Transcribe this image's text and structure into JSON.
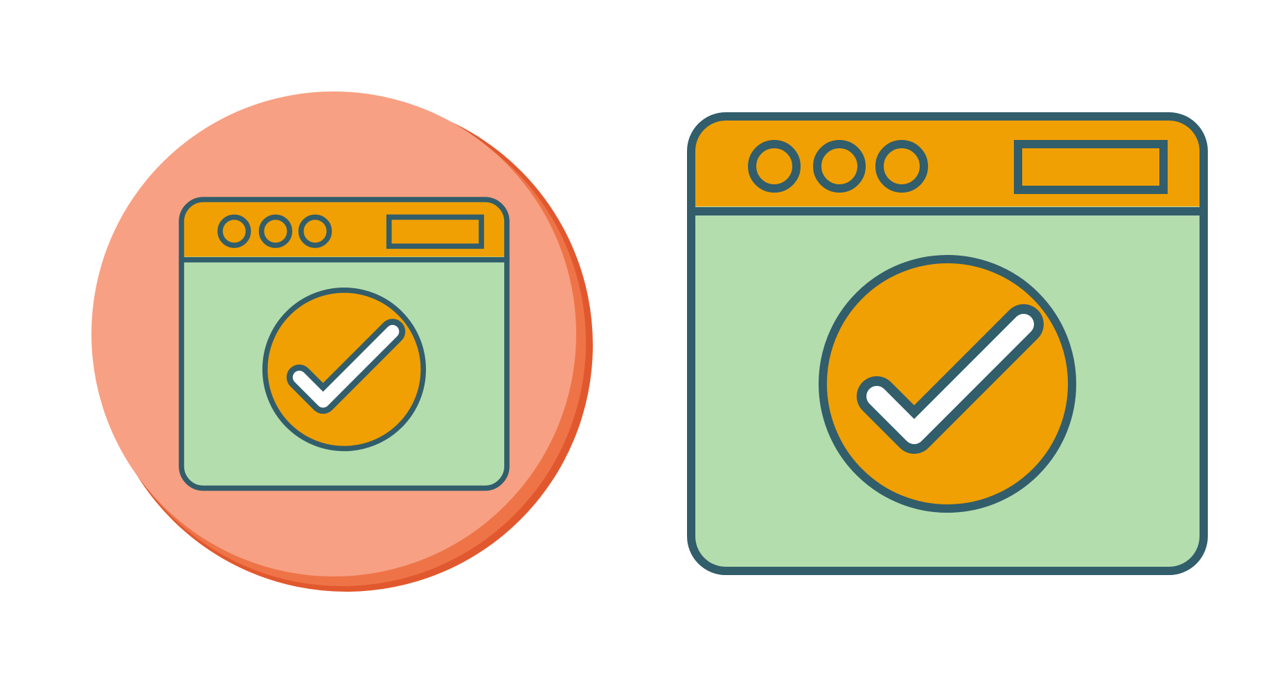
{
  "icons": [
    {
      "name": "browser-window-check-icon",
      "style": "circle-badge",
      "colors": {
        "badge": "#F8A083",
        "badge_shadow": "#EE7448",
        "badge_shadow_dark": "#E2582E",
        "outline": "#325D6B",
        "titlebar": "#F0A002",
        "body": "#B4DDAE",
        "checkmark": "#FFFFFF"
      }
    },
    {
      "name": "browser-window-check-icon",
      "style": "flat",
      "colors": {
        "outline": "#325D6B",
        "titlebar": "#F0A002",
        "body": "#B4DDAE",
        "checkmark": "#FFFFFF"
      }
    }
  ]
}
